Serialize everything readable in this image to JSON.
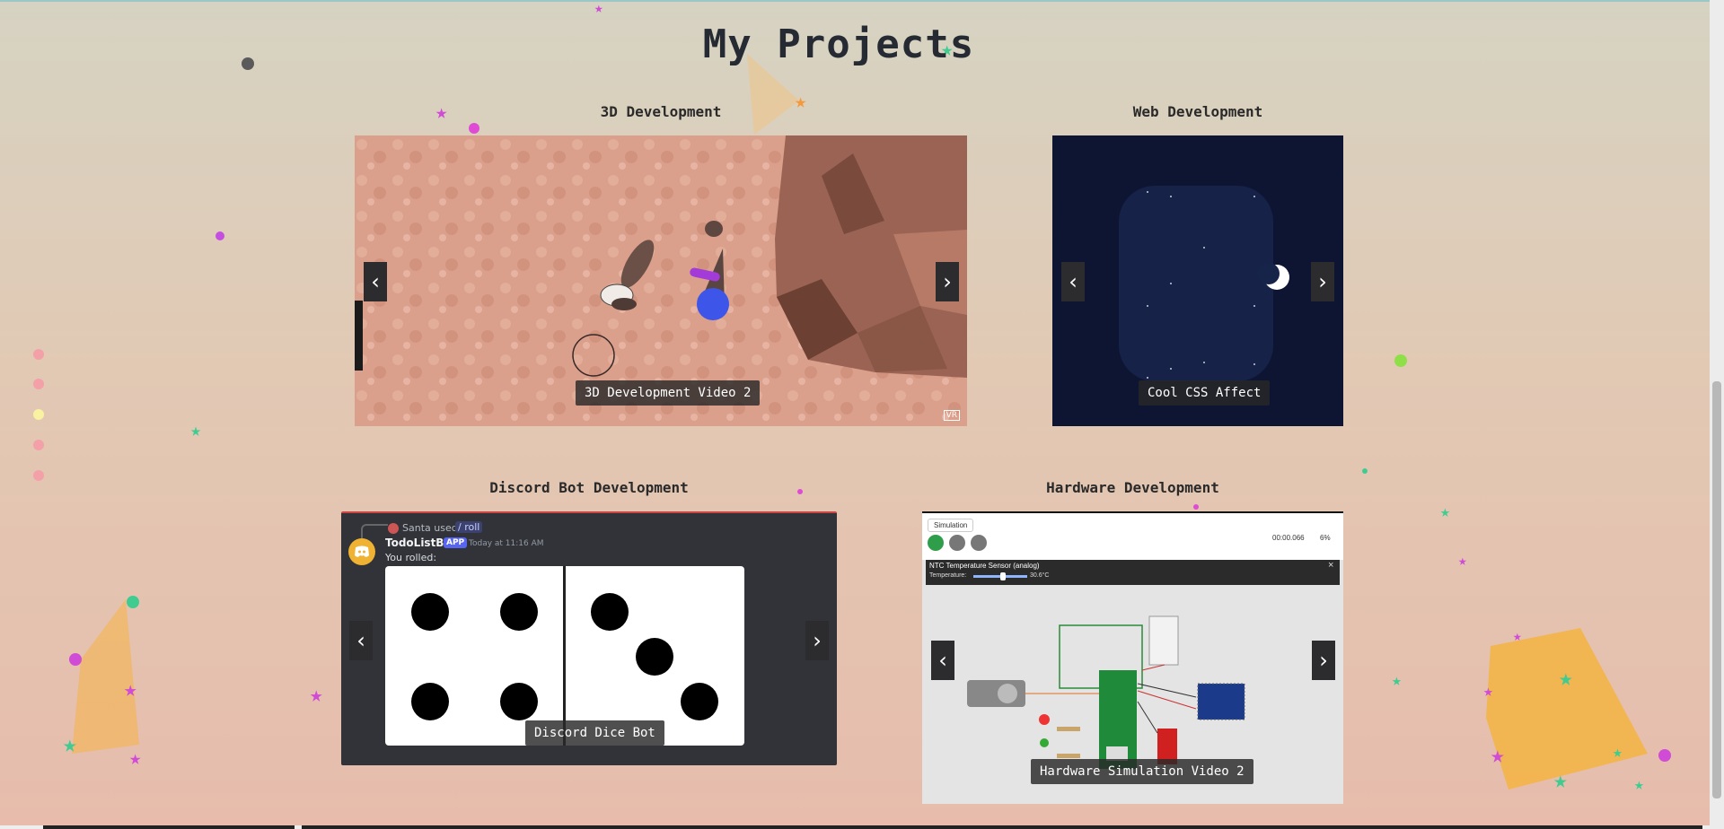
{
  "page": {
    "title": "My Projects"
  },
  "colors": {
    "accent_discord": "#5865f2",
    "discord_bg": "#313338",
    "web_bg": "#0d1533",
    "caption_bg": "#282828"
  },
  "projects": [
    {
      "id": "3d",
      "section_title": "3D Development",
      "caption": "3D Development Video 2",
      "badge": "VR",
      "prev_icon": "‹",
      "next_icon": "›"
    },
    {
      "id": "web",
      "section_title": "Web Development",
      "caption": "Cool CSS Affect",
      "prev_icon": "‹",
      "next_icon": "›"
    },
    {
      "id": "discord",
      "section_title": "Discord Bot Development",
      "caption": "Discord Dice Bot",
      "prev_icon": "‹",
      "next_icon": "›",
      "discord": {
        "reply_user": "Santa used",
        "reply_command": "/ roll",
        "bot_name": "TodoListBot",
        "bot_tag": "APP",
        "timestamp": "Today at 11:16 AM",
        "message": "You rolled:"
      }
    },
    {
      "id": "hardware",
      "section_title": "Hardware Development",
      "caption": "Hardware Simulation Video 2",
      "prev_icon": "‹",
      "next_icon": "›",
      "hardware": {
        "tab": "Simulation",
        "timer": "00:00.066",
        "speed": "6%",
        "sensor_title": "NTC Temperature Sensor (analog)",
        "temp_label": "Temperature:",
        "temp_value": "30.6°C",
        "close_icon": "×"
      }
    }
  ]
}
